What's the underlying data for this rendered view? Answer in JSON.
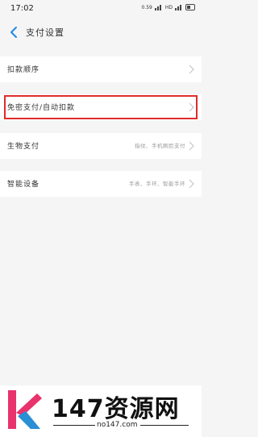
{
  "status": {
    "time": "17:02",
    "network": "0.59",
    "hd": "HD"
  },
  "header": {
    "title": "支付设置"
  },
  "rows": [
    {
      "label": "扣款顺序",
      "value": ""
    },
    {
      "label": "免密支付/自动扣款",
      "value": ""
    },
    {
      "label": "生物支付",
      "value": "指纹、手机刷脸支付"
    },
    {
      "label": "智能设备",
      "value": "手表、手环、智能手环"
    }
  ],
  "watermark": {
    "name": "147资源网",
    "url": "no147.com"
  },
  "colors": {
    "highlight": "#e02b2b",
    "background": "#f5f5f5",
    "accent": "#1e88e5"
  }
}
